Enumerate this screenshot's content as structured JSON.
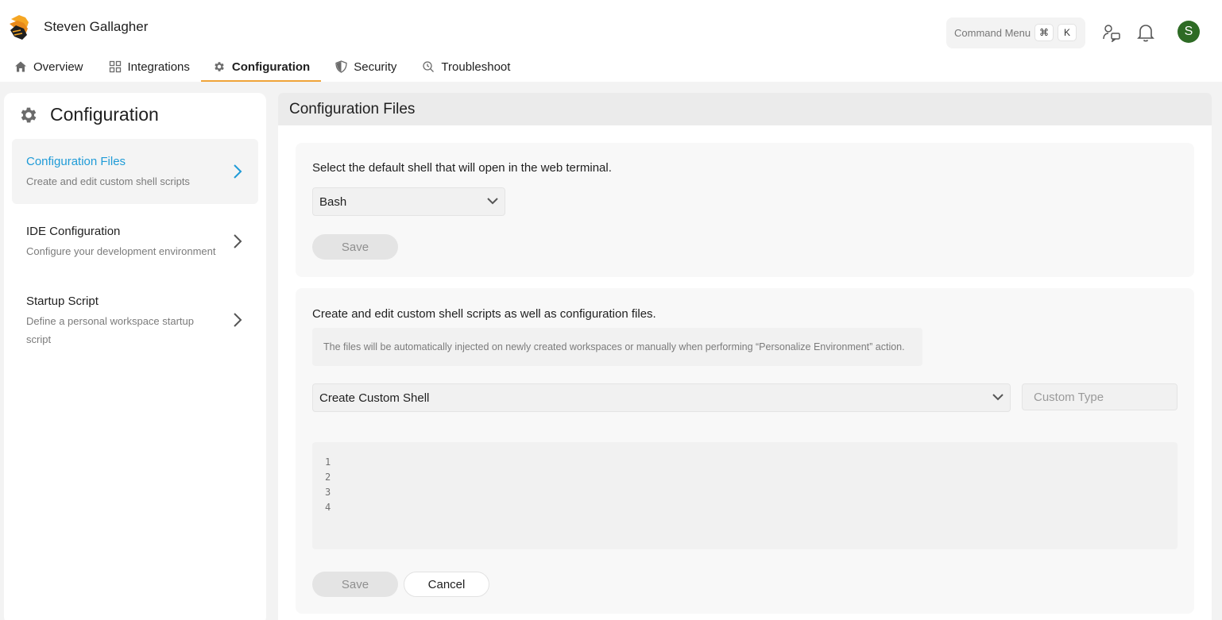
{
  "header": {
    "user_name": "Steven Gallagher",
    "command_menu": {
      "label": "Command Menu",
      "key_modifier": "⌘",
      "key": "K"
    },
    "avatar_initial": "S",
    "icons": [
      "logo-icon",
      "support-chat-icon",
      "bell-icon"
    ]
  },
  "nav": {
    "tabs": [
      {
        "label": "Overview",
        "icon": "home-icon"
      },
      {
        "label": "Integrations",
        "icon": "grid-icon"
      },
      {
        "label": "Configuration",
        "icon": "gear-icon",
        "active": true
      },
      {
        "label": "Security",
        "icon": "shield-icon"
      },
      {
        "label": "Troubleshoot",
        "icon": "troubleshoot-icon"
      }
    ]
  },
  "sidebar": {
    "title": "Configuration",
    "items": [
      {
        "title": "Configuration Files",
        "description": "Create and edit custom shell scripts",
        "active": true
      },
      {
        "title": "IDE Configuration",
        "description": "Configure your development environment"
      },
      {
        "title": "Startup Script",
        "description": "Define a personal workspace startup script"
      }
    ]
  },
  "main": {
    "title": "Configuration Files",
    "shell_card": {
      "prompt": "Select the default shell that will open in the web terminal.",
      "selected_shell": "Bash",
      "save_label": "Save"
    },
    "scripts_card": {
      "prompt": "Create and edit custom shell scripts as well as configuration files.",
      "info": "The files will be automatically injected on newly created workspaces or manually when performing “Personalize Environment” action.",
      "file_select": "Create Custom Shell",
      "custom_type_placeholder": "Custom Type",
      "line_numbers": [
        "1",
        "2",
        "3",
        "4"
      ],
      "save_label": "Save",
      "cancel_label": "Cancel"
    }
  },
  "colors": {
    "accent_orange": "#f0a43a",
    "link_blue": "#1f9bd7",
    "avatar_green": "#2e6b25"
  }
}
